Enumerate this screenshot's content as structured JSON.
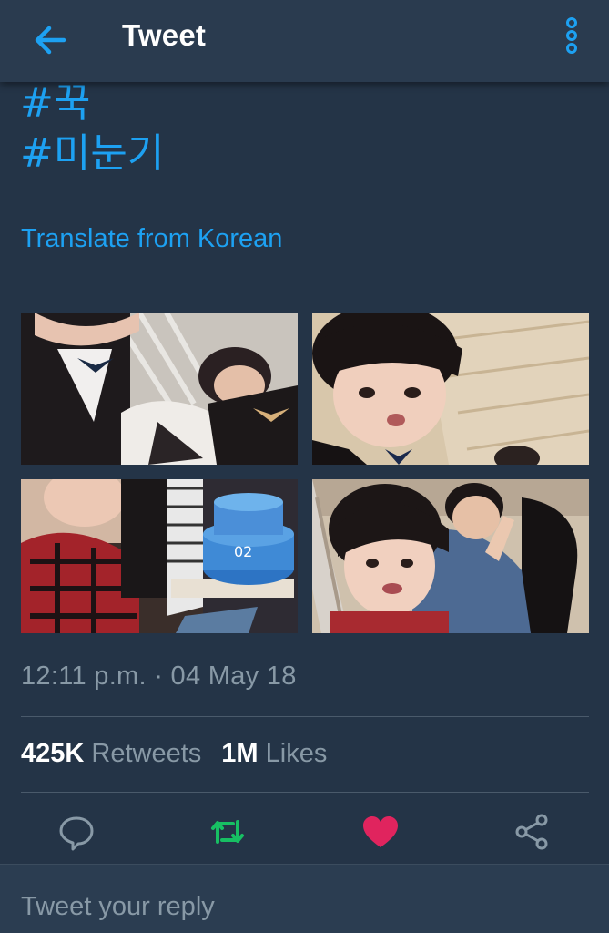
{
  "header": {
    "title": "Tweet",
    "back_icon": "arrow-left-icon",
    "more_icon": "vertical-dots-icon",
    "accent": "#1da1f2"
  },
  "tweet": {
    "hashtags": [
      "#꾹",
      "#미눈기"
    ],
    "translate_label": "Translate from Korean",
    "photos": [
      {
        "name": "photo-1"
      },
      {
        "name": "photo-2"
      },
      {
        "name": "photo-3"
      },
      {
        "name": "photo-4"
      }
    ],
    "timestamp": "12:11 p.m. · 04 May 18",
    "retweets_count": "425K",
    "retweets_label": "Retweets",
    "likes_count": "1M",
    "likes_label": "Likes"
  },
  "actions": {
    "reply_icon": "speech-bubble-icon",
    "retweet_icon": "retweet-icon",
    "retweet_color": "#17bf63",
    "like_icon": "heart-icon",
    "like_color": "#e0245e",
    "share_icon": "share-icon"
  },
  "reply": {
    "placeholder": "Tweet your reply"
  }
}
